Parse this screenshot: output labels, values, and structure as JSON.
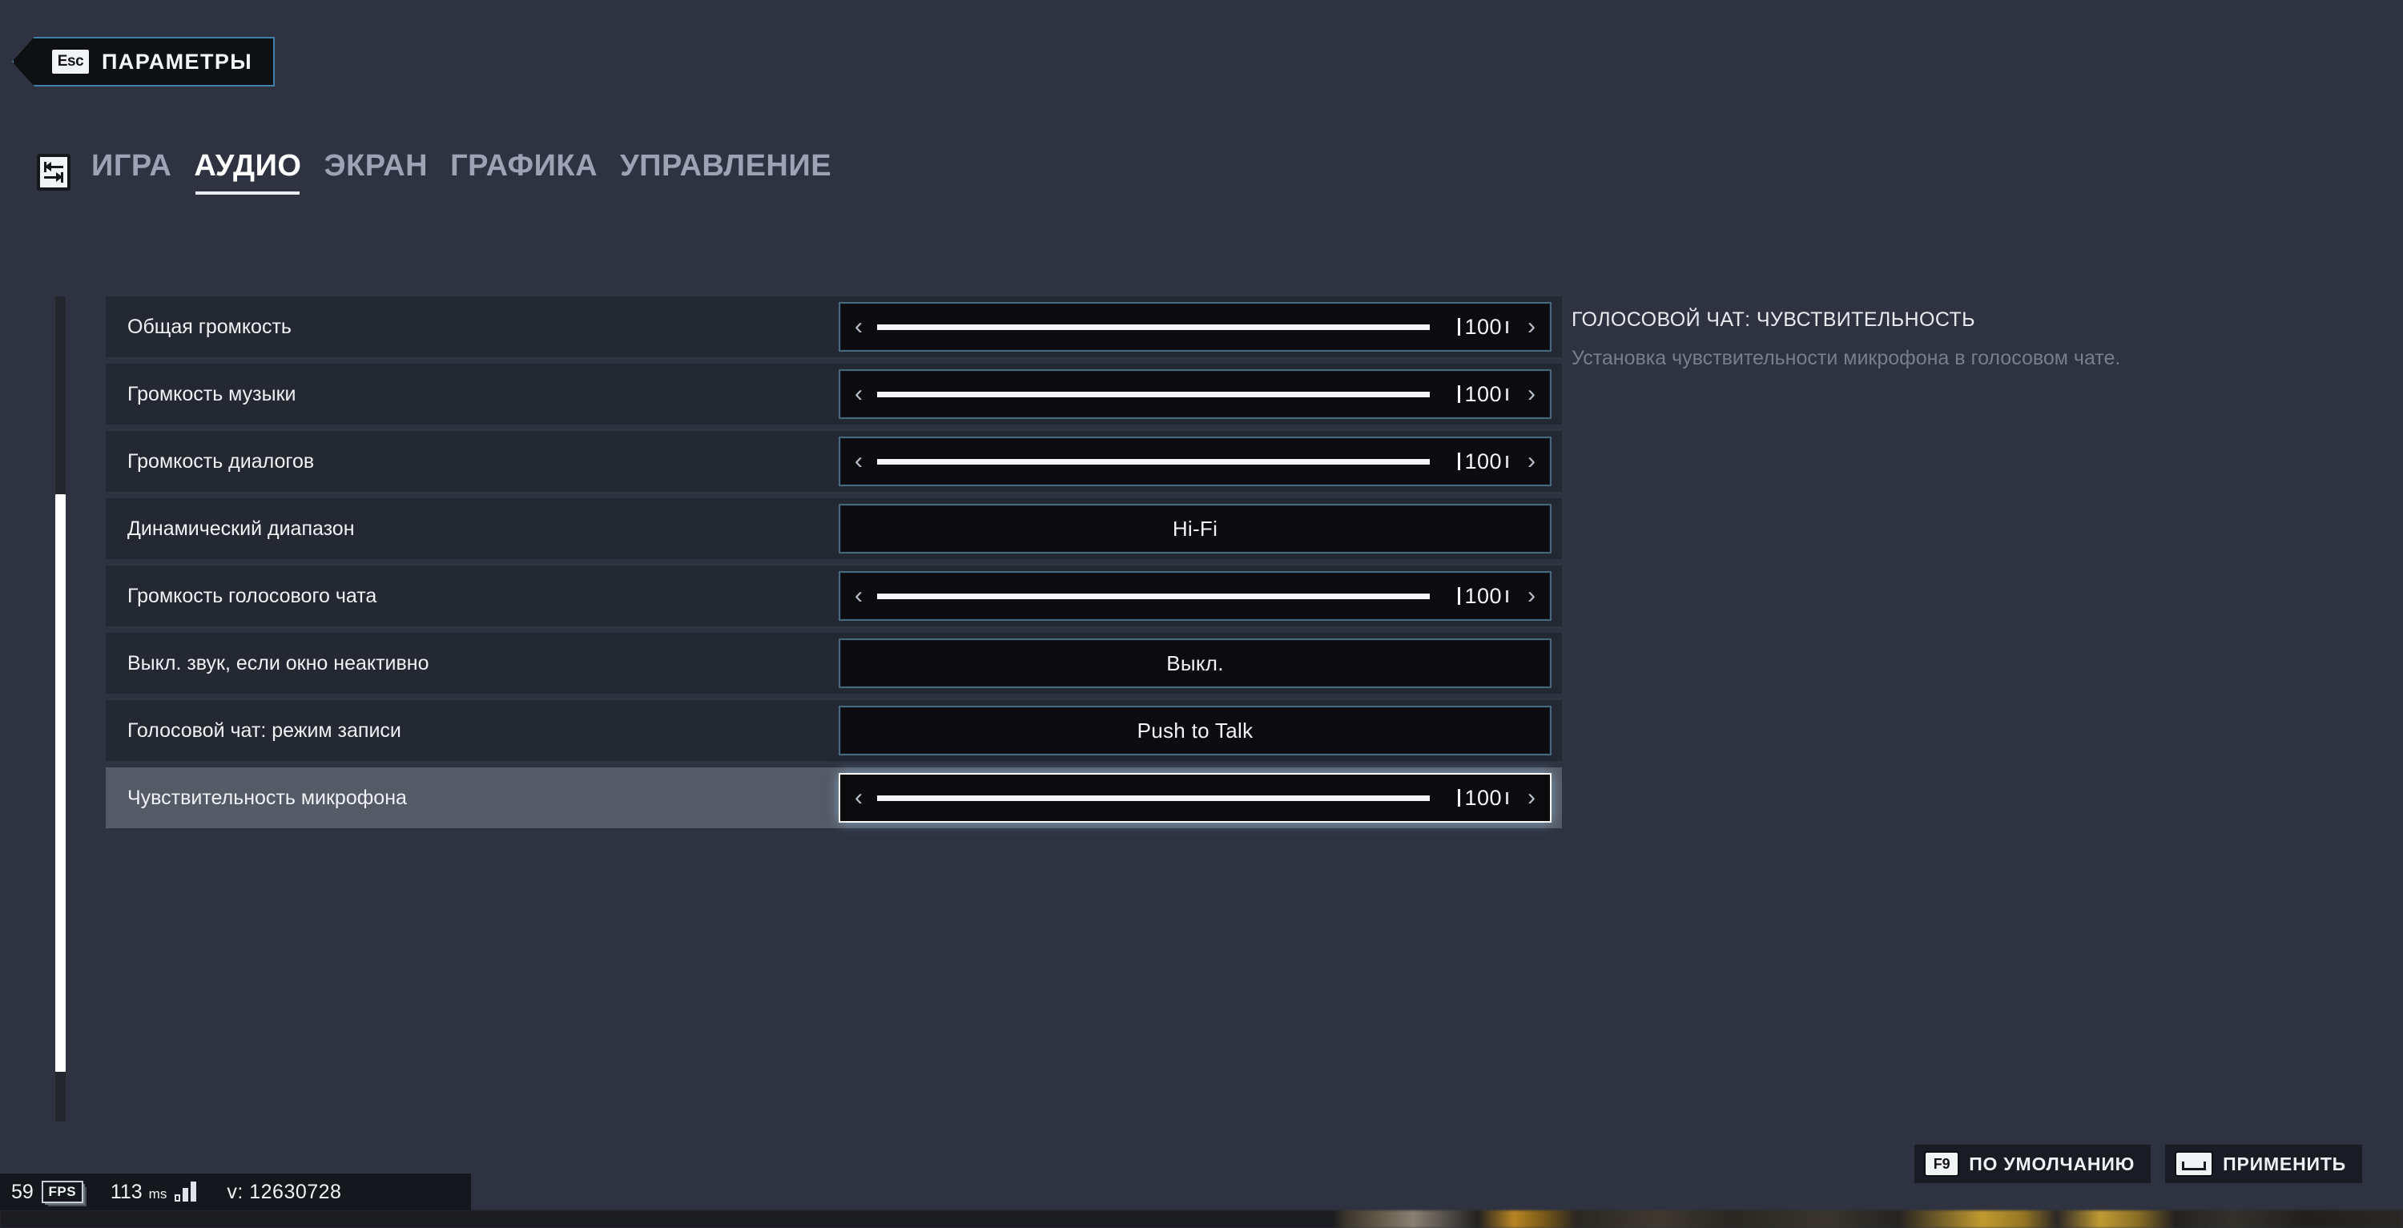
{
  "header": {
    "back_key": "Esc",
    "title": "ПАРАМЕТРЫ"
  },
  "tabs": {
    "switch_icon": "tab-switch-icon",
    "items": [
      {
        "label": "ИГРА",
        "active": false
      },
      {
        "label": "АУДИО",
        "active": true
      },
      {
        "label": "ЭКРАН",
        "active": false
      },
      {
        "label": "ГРАФИКА",
        "active": false
      },
      {
        "label": "УПРАВЛЕНИЕ",
        "active": false
      }
    ]
  },
  "settings": {
    "rows": [
      {
        "label": "Общая громкость",
        "type": "slider",
        "value": "100"
      },
      {
        "label": "Громкость музыки",
        "type": "slider",
        "value": "100"
      },
      {
        "label": "Громкость диалогов",
        "type": "slider",
        "value": "100"
      },
      {
        "label": "Динамический диапазон",
        "type": "combo",
        "value": "Hi-Fi"
      },
      {
        "label": "Громкость голосового чата",
        "type": "slider",
        "value": "100"
      },
      {
        "label": "Выкл. звук, если окно неактивно",
        "type": "combo",
        "value": "Выкл."
      },
      {
        "label": "Голосовой чат: режим записи",
        "type": "combo",
        "value": "Push to Talk"
      },
      {
        "label": "Чувствительность микрофона",
        "type": "slider",
        "value": "100",
        "selected": true
      }
    ]
  },
  "description": {
    "title": "ГОЛОСОВОЙ ЧАТ: ЧУВСТВИТЕЛЬНОСТЬ",
    "body": "Установка чувствительности микрофона в голосовом чате."
  },
  "actions": [
    {
      "key": "F9",
      "label": "ПО УМОЛЧАНИЮ",
      "key_icon": "f9-key-icon"
    },
    {
      "key": "",
      "label": "ПРИМЕНИТЬ",
      "key_icon": "spacebar-key-icon"
    }
  ],
  "perf": {
    "fps": "59",
    "fps_unit": "FPS",
    "latency": "113",
    "latency_unit": "ms",
    "version": "v: 12630728"
  },
  "colors": {
    "page_bg": "#2e3241",
    "row_bg": "#242833",
    "row_selected_bg": "#555a67",
    "control_bg": "#0c0c0e",
    "control_border": "#47697e",
    "accent_blue": "#3f7fa8",
    "text_primary": "#f0f2f6",
    "text_muted": "#777e8d",
    "tab_inactive": "#9ba3b4"
  },
  "scrollbar": {
    "thumb_top_pct": 24,
    "thumb_height_pct": 70
  }
}
